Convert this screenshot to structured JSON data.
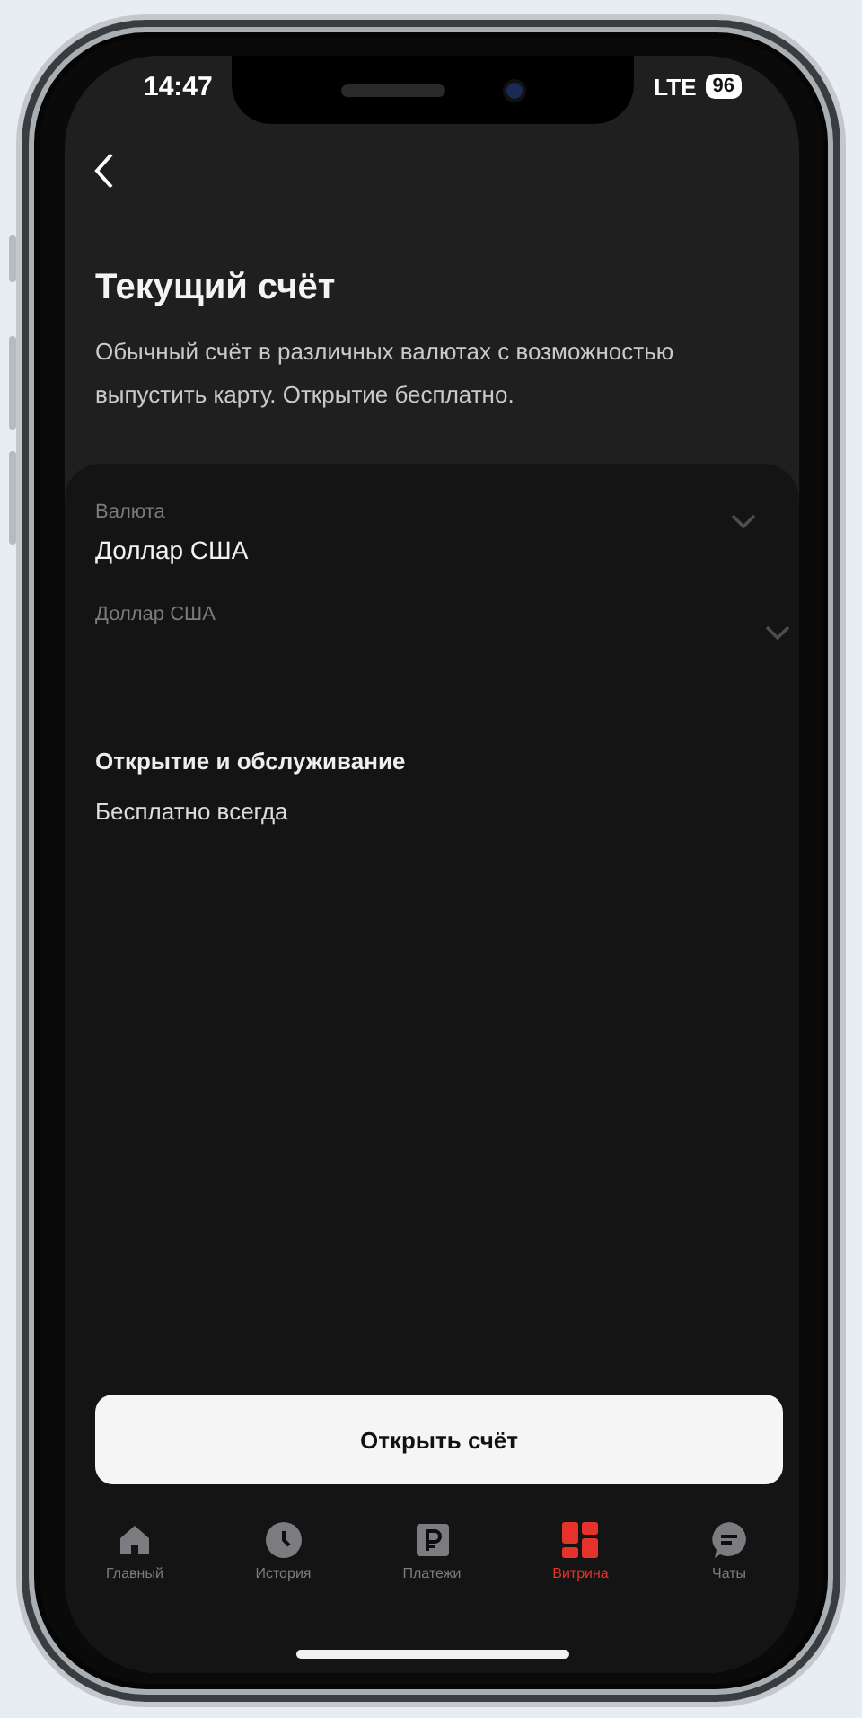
{
  "status_bar": {
    "time": "14:47",
    "network": "LTE",
    "battery": "96"
  },
  "header": {
    "title": "Текущий счёт",
    "description": "Обычный счёт в различных валютах с возможностью выпустить карту. Открытие бесплатно."
  },
  "fields": [
    {
      "label": "Валюта",
      "value": "Доллар США"
    },
    {
      "label": "Доллар США"
    }
  ],
  "info": {
    "title": "Открытие и обслуживание",
    "text": "Бесплатно всегда"
  },
  "primary_button": "Открыть счёт",
  "tabs": [
    {
      "label": "Главный",
      "selected": false
    },
    {
      "label": "История",
      "selected": false
    },
    {
      "label": "Платежи",
      "selected": false
    },
    {
      "label": "Витрина",
      "selected": true
    },
    {
      "label": "Чаты",
      "selected": false
    }
  ]
}
